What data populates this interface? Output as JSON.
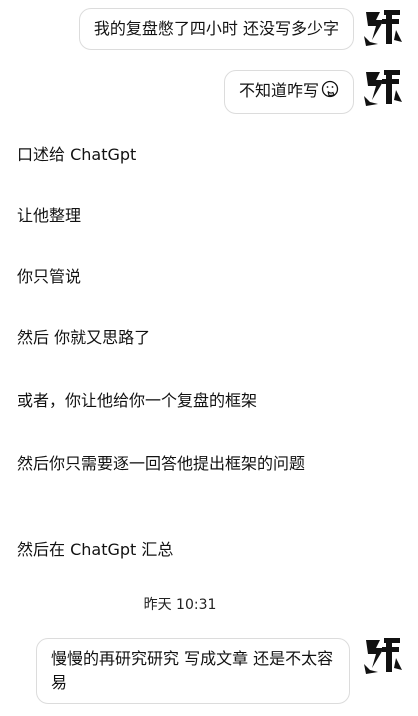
{
  "messages": {
    "sent_1": {
      "text": "我的复盘憋了四小时 还没写多少字"
    },
    "sent_2": {
      "text": "不知道咋写",
      "emoji": "face-with-hand-over-mouth-icon"
    },
    "received": [
      {
        "text": "口述给 ChatGpt"
      },
      {
        "text": "让他整理"
      },
      {
        "text": "你只管说"
      },
      {
        "text": "然后 你就又思路了"
      },
      {
        "text": "或者，你让他给你一个复盘的框架"
      },
      {
        "text": "然后你只需要逐一回答他提出框架的问题"
      },
      {
        "text": "然后在 ChatGpt 汇总"
      }
    ],
    "timestamp": "昨天 10:31",
    "sent_3": {
      "text": "慢慢的再研究研究  写成文章 还是不太容易"
    }
  },
  "colors": {
    "background": "#ffffff",
    "bubble_border": "#dcdcdc",
    "text": "#111111"
  }
}
